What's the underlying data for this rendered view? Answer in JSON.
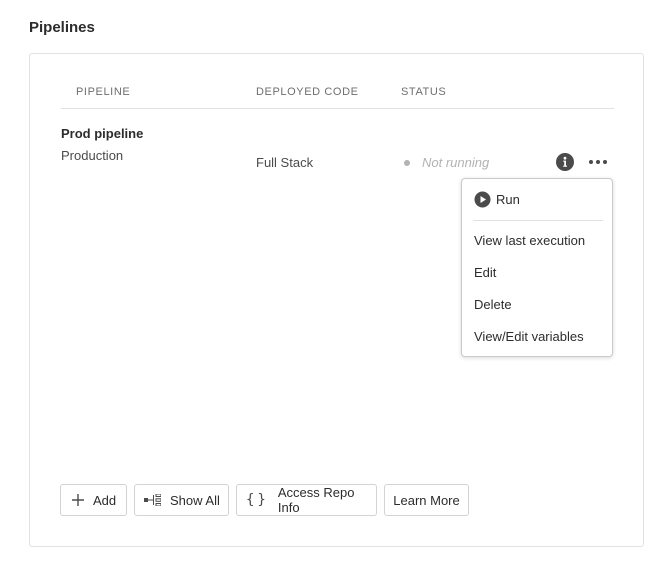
{
  "section": {
    "title": "Pipelines"
  },
  "table": {
    "headers": {
      "pipeline": "PIPELINE",
      "deployed_code": "DEPLOYED CODE",
      "status": "STATUS"
    },
    "rows": [
      {
        "name": "Prod pipeline",
        "environment": "Production",
        "deployed_code": "Full Stack",
        "status": "Not running"
      }
    ]
  },
  "row_actions": {
    "info_icon": "info-icon",
    "more_icon": "more-horizontal-icon"
  },
  "menu": {
    "run_label": "Run",
    "run_icon": "play-circle-icon",
    "items": [
      "View last execution",
      "Edit",
      "Delete",
      "View/Edit variables"
    ]
  },
  "footer_buttons": {
    "add": {
      "label": "Add",
      "icon": "plus-icon"
    },
    "show_all": {
      "label": "Show All",
      "icon": "workflow-icon"
    },
    "access_repo": {
      "label": "Access Repo Info",
      "icon": "braces-icon"
    },
    "learn_more": {
      "label": "Learn More"
    }
  },
  "colors": {
    "text": "#2c2c2c",
    "muted": "#b3b3b3",
    "border": "#e1e1e1",
    "icon": "#4b4b4b"
  }
}
